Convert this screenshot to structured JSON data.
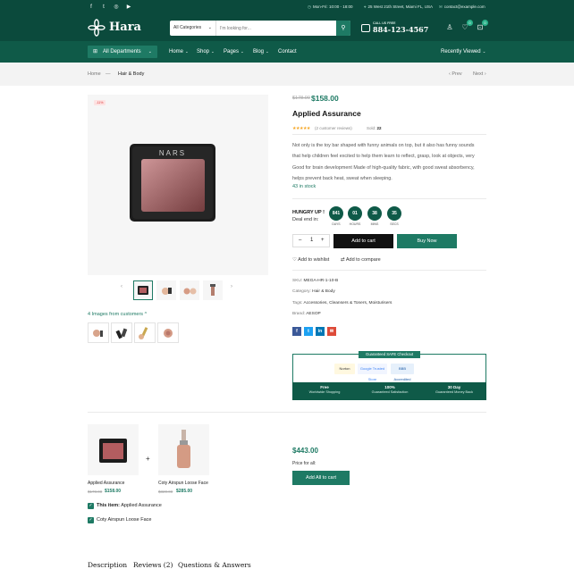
{
  "topbar": {
    "hours": "Mon-Fri: 10:00 - 18:00",
    "address": "25 West 21th Street, Miami FL, USA",
    "email": "contact@example.com",
    "social": [
      "facebook-icon",
      "twitter-icon",
      "instagram-icon",
      "youtube-icon"
    ]
  },
  "header": {
    "logo": "Hara",
    "search_category": "All Categories",
    "search_placeholder": "I'm looking for...",
    "call_label": "CALL US FREE",
    "phone": "884-123-4567",
    "wishlist_count": "0",
    "cart_count": "0"
  },
  "nav": {
    "departments": "All Departments",
    "items": [
      "Home",
      "Shop",
      "Pages",
      "Blog",
      "Contact"
    ],
    "recent": "Recently Viewed"
  },
  "breadcrumb": {
    "home": "Home",
    "current": "Hair & Body",
    "prev": "Prev",
    "next": "Next"
  },
  "gallery": {
    "badge": "-11%",
    "customer_images": "4 Images from customers"
  },
  "product": {
    "old_price": "$178.00",
    "price": "$158.00",
    "title": "Applied Assurance",
    "stars": "★★★★★",
    "reviews": "(2 customer reviews)",
    "sold_label": "Sold:",
    "sold_count": "22",
    "description": "Not only is the toy bar shaped with funny animals on top, but it also has funny sounds that help children feel excited to help them learn to reflect, grasp, look at objects, very Good for brain development Made of high-quality fabric, with good sweat absorbency, helps prevent back heat, sweat when sleeping.",
    "stock": "43 in stock",
    "deal_title": "HUNGRY UP !",
    "deal_sub": "Deal end in:",
    "countdown": [
      {
        "value": "841",
        "label": "DAYS"
      },
      {
        "value": "01",
        "label": "HOURS"
      },
      {
        "value": "38",
        "label": "MINS"
      },
      {
        "value": "35",
        "label": "SECS"
      }
    ],
    "qty": "1",
    "add_to_cart": "Add to cart",
    "buy_now": "Buy Now",
    "wishlist": "Add to wishlist",
    "compare": "Add to compare",
    "sku_label": "SKU:",
    "sku": "MEGA-HR-1-10-B",
    "category_label": "Category:",
    "category": "Hair & Body",
    "tags_label": "Tags:",
    "tags": "Accessories, Cleansers & Toners, Moisturisers",
    "brand_label": "Brand:",
    "brand": "AESOP"
  },
  "checkout": {
    "title": "Guaranteed SAFE Checkout",
    "trust": [
      "Norton",
      "Google Trusted Store",
      "BBB Accredited"
    ],
    "features": [
      {
        "title": "Free",
        "sub": "Worldwide Shopping"
      },
      {
        "title": "100%",
        "sub": "Guaranteed Satisfaction"
      },
      {
        "title": "30 Day",
        "sub": "Guaranteed Money Back"
      }
    ]
  },
  "bundle": {
    "items": [
      {
        "name": "Applied Assurance",
        "old": "$178.00",
        "price": "$158.00"
      },
      {
        "name": "Coty Airspun Loose Face",
        "old": "$320.00",
        "price": "$285.00"
      }
    ],
    "total": "$443.00",
    "price_label": "Price for all:",
    "add_all": "Add All to cart",
    "check1_bold": "This item:",
    "check1": "Applied Assurance",
    "check2": "Coty Airspun Loose Face"
  },
  "tabs": [
    "Description",
    "Reviews (2)",
    "Questions & Answers"
  ],
  "colors": {
    "primary": "#0b4a3c",
    "accent": "#1e7a64",
    "sale": "#d33333"
  }
}
